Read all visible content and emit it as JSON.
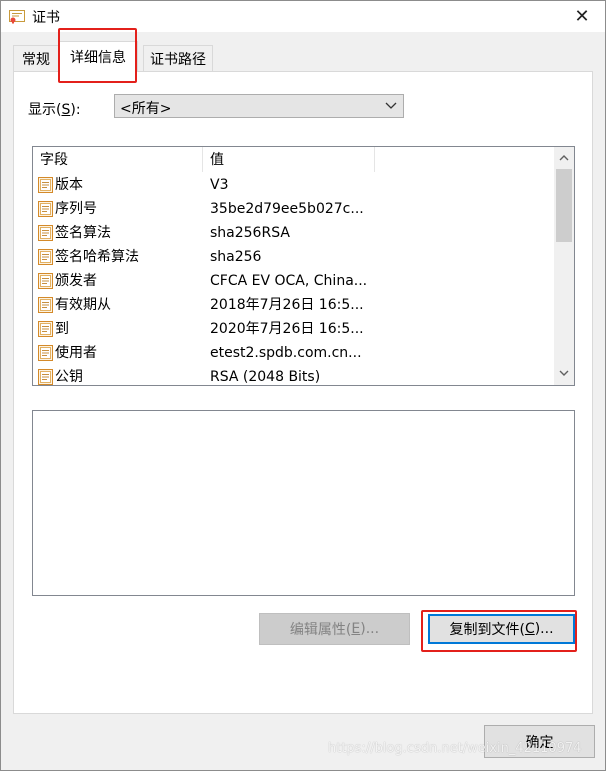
{
  "window": {
    "title": "证书",
    "close_glyph": "✕"
  },
  "tabs": [
    {
      "label": "常规",
      "active": false
    },
    {
      "label": "详细信息",
      "active": true
    },
    {
      "label": "证书路径",
      "active": false
    }
  ],
  "show": {
    "label_prefix": "显示(",
    "label_key": "S",
    "label_suffix": "):",
    "selected": "<所有>"
  },
  "list": {
    "columns": [
      "字段",
      "值"
    ],
    "rows": [
      {
        "field": "版本",
        "value": "V3"
      },
      {
        "field": "序列号",
        "value": "35be2d79ee5b027c..."
      },
      {
        "field": "签名算法",
        "value": "sha256RSA"
      },
      {
        "field": "签名哈希算法",
        "value": "sha256"
      },
      {
        "field": "颁发者",
        "value": "CFCA EV OCA, China..."
      },
      {
        "field": "有效期从",
        "value": "2018年7月26日 16:5..."
      },
      {
        "field": "到",
        "value": "2020年7月26日 16:5..."
      },
      {
        "field": "使用者",
        "value": "etest2.spdb.com.cn..."
      },
      {
        "field": "公钥",
        "value": "RSA (2048 Bits)"
      }
    ]
  },
  "buttons": {
    "edit_prefix": "编辑属性(",
    "edit_key": "E",
    "edit_suffix": ")...",
    "copy_prefix": "复制到文件(",
    "copy_key": "C",
    "copy_suffix": ")...",
    "ok": "确定"
  },
  "watermark": "https://blog.csdn.net/weixin_42110974",
  "colors": {
    "highlight": "#e3201b",
    "focus": "#0078d7",
    "cert_icon": "#e8a33a"
  }
}
